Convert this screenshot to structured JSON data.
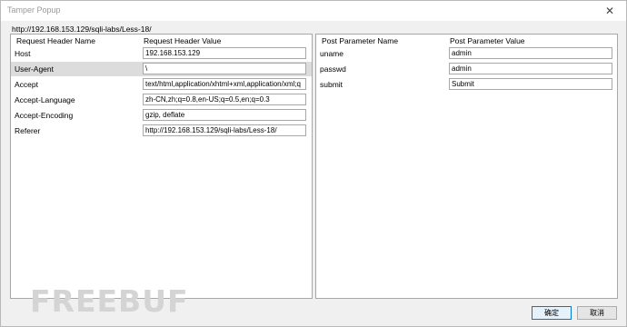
{
  "window": {
    "title": "Tamper Popup",
    "close_glyph": "✕",
    "url": "http://192.168.153.129/sqli-labs/Less-18/"
  },
  "headers": {
    "col_name": "Request Header Name",
    "col_value": "Request Header Value",
    "rows": [
      {
        "name": "Host",
        "value": "192.168.153.129"
      },
      {
        "name": "User-Agent",
        "value": "\\"
      },
      {
        "name": "Accept",
        "value": "text/html,application/xhtml+xml,application/xml;q"
      },
      {
        "name": "Accept-Language",
        "value": "zh-CN,zh;q=0.8,en-US;q=0.5,en;q=0.3"
      },
      {
        "name": "Accept-Encoding",
        "value": "gzip, deflate"
      },
      {
        "name": "Referer",
        "value": "http://192.168.153.129/sqli-labs/Less-18/"
      }
    ],
    "selected_row": "User-Agent"
  },
  "params": {
    "col_name": "Post Parameter Name",
    "col_value": "Post Parameter Value",
    "rows": [
      {
        "name": "uname",
        "value": "admin"
      },
      {
        "name": "passwd",
        "value": "admin"
      },
      {
        "name": "submit",
        "value": "Submit"
      }
    ]
  },
  "watermark": "FREEBUF",
  "buttons": {
    "ok": "确定",
    "cancel": "取消"
  }
}
